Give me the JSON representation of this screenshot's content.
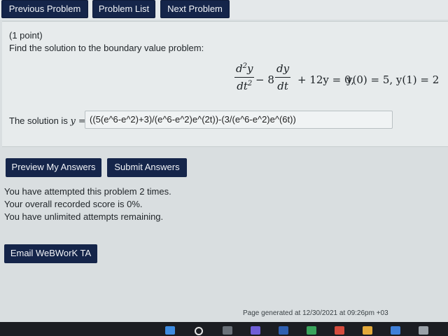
{
  "nav": {
    "previous": "Previous Problem",
    "list": "Problem List",
    "next": "Next Problem"
  },
  "problem": {
    "points": "(1 point)",
    "prompt": "Find the solution to the boundary value problem:",
    "equation": {
      "frac1_num": "d",
      "frac1_num_sup": "2",
      "frac1_num_var": "y",
      "frac1_den": "dt",
      "frac1_den_sup": "2",
      "minus8": "− 8",
      "frac2_num": "dy",
      "frac2_den": "dt",
      "rest": "+ 12y = 0,",
      "bc": "y(0) = 5, y(1) = 2"
    },
    "solution_prefix": "The solution is",
    "solution_var": "y =",
    "answer_value": "((5(e^6-e^2)+3)/(e^6-e^2)e^(2t))-(3/(e^6-e^2)e^(6t))"
  },
  "actions": {
    "preview": "Preview My Answers",
    "submit": "Submit Answers"
  },
  "status": {
    "line1": "You have attempted this problem 2 times.",
    "line2": "Your overall recorded score is 0%.",
    "line3": "You have unlimited attempts remaining."
  },
  "email": "Email WeBWorK TA",
  "footer": "Page generated at 12/30/2021 at 09:26pm +03",
  "taskbar": {
    "icons": [
      "windows-start-icon",
      "search-icon",
      "task-view-icon",
      "chat-icon",
      "app-icon",
      "app-icon",
      "app-icon",
      "app-icon",
      "app-icon",
      "app-icon"
    ]
  },
  "colors": {
    "button": "#15254a",
    "page_bg": "#d9dee0",
    "panel_bg": "#e7ebec"
  }
}
